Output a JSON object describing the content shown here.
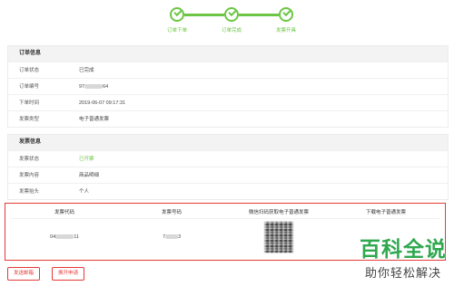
{
  "steps": [
    {
      "label": "订单下单"
    },
    {
      "label": "订单完成"
    },
    {
      "label": "发票开具"
    }
  ],
  "order_info": {
    "title": "订单信息",
    "rows": [
      {
        "key": "订单状态",
        "value": "已完成"
      },
      {
        "key": "订单编号",
        "value": "97",
        "value_tail": "64"
      },
      {
        "key": "下单时间",
        "value": "2019-06-07 09:17:31"
      },
      {
        "key": "发票类型",
        "value": "电子普通发票"
      }
    ]
  },
  "invoice_info": {
    "title": "发票信息",
    "rows": [
      {
        "key": "发票状态",
        "value": "已开票"
      },
      {
        "key": "发票内容",
        "value": "商品明细"
      },
      {
        "key": "发票抬头",
        "value": "个人"
      }
    ]
  },
  "invoice_table": {
    "headers": [
      "发票代码",
      "发票号码",
      "微信扫码获取电子普通发票",
      "下载电子普通发票"
    ],
    "code_prefix": "04",
    "code_suffix": "11",
    "number_prefix": "7",
    "number_suffix": "3"
  },
  "buttons": {
    "send_email": "发送邮箱",
    "change_title": "换开申请"
  },
  "watermark": {
    "brand": "百科全说",
    "slogan": "助你轻松解决"
  },
  "colors": {
    "accent_green": "#6cc644",
    "highlight_red": "#e53935",
    "watermark_green": "#2fa84f"
  }
}
